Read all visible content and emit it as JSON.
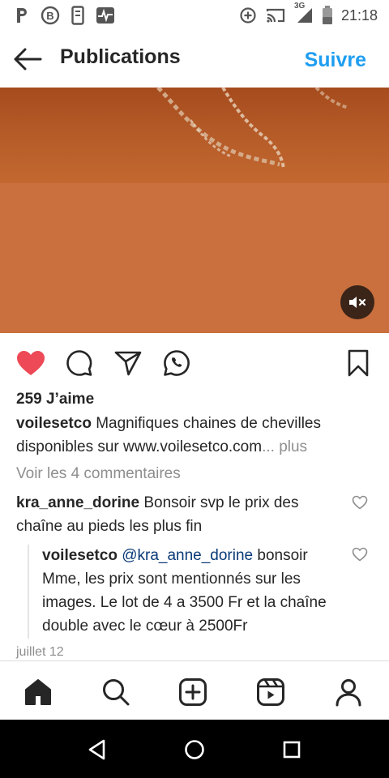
{
  "status_bar": {
    "time": "21:18",
    "network_label": "3G",
    "left_icons": [
      "parking-icon",
      "b-circle-icon",
      "phone-icon",
      "activity-icon"
    ],
    "right_icons": [
      "data-saver-icon",
      "cast-icon",
      "signal-icon",
      "battery-icon"
    ]
  },
  "header": {
    "title": "Publications",
    "follow_label": "Suivre"
  },
  "media": {
    "top_color": "#a64b1d",
    "bottom_color": "#c9703e"
  },
  "post": {
    "likes": "259 J’aime",
    "caption": {
      "username": "voilesetco",
      "text": " Magnifiques chaines de chevilles disponibles sur www.voilesetco.com",
      "more": "... plus"
    },
    "view_comments": "Voir les 4 commentaires",
    "comments": [
      {
        "username": "kra_anne_dorine",
        "text": " Bonsoir svp le prix des chaîne au pieds les plus fin"
      },
      {
        "username": "voilesetco",
        "mention": "@kra_anne_dorine",
        "text": " bonsoir Mme, les prix sont mentionnés sur les images. Le lot de 4 a 3500 Fr et la chaîne double avec le cœur à 2500Fr"
      }
    ],
    "date": "juillet 12"
  },
  "colors": {
    "accent": "#1e9ef0",
    "liked_heart": "#ed4956"
  }
}
